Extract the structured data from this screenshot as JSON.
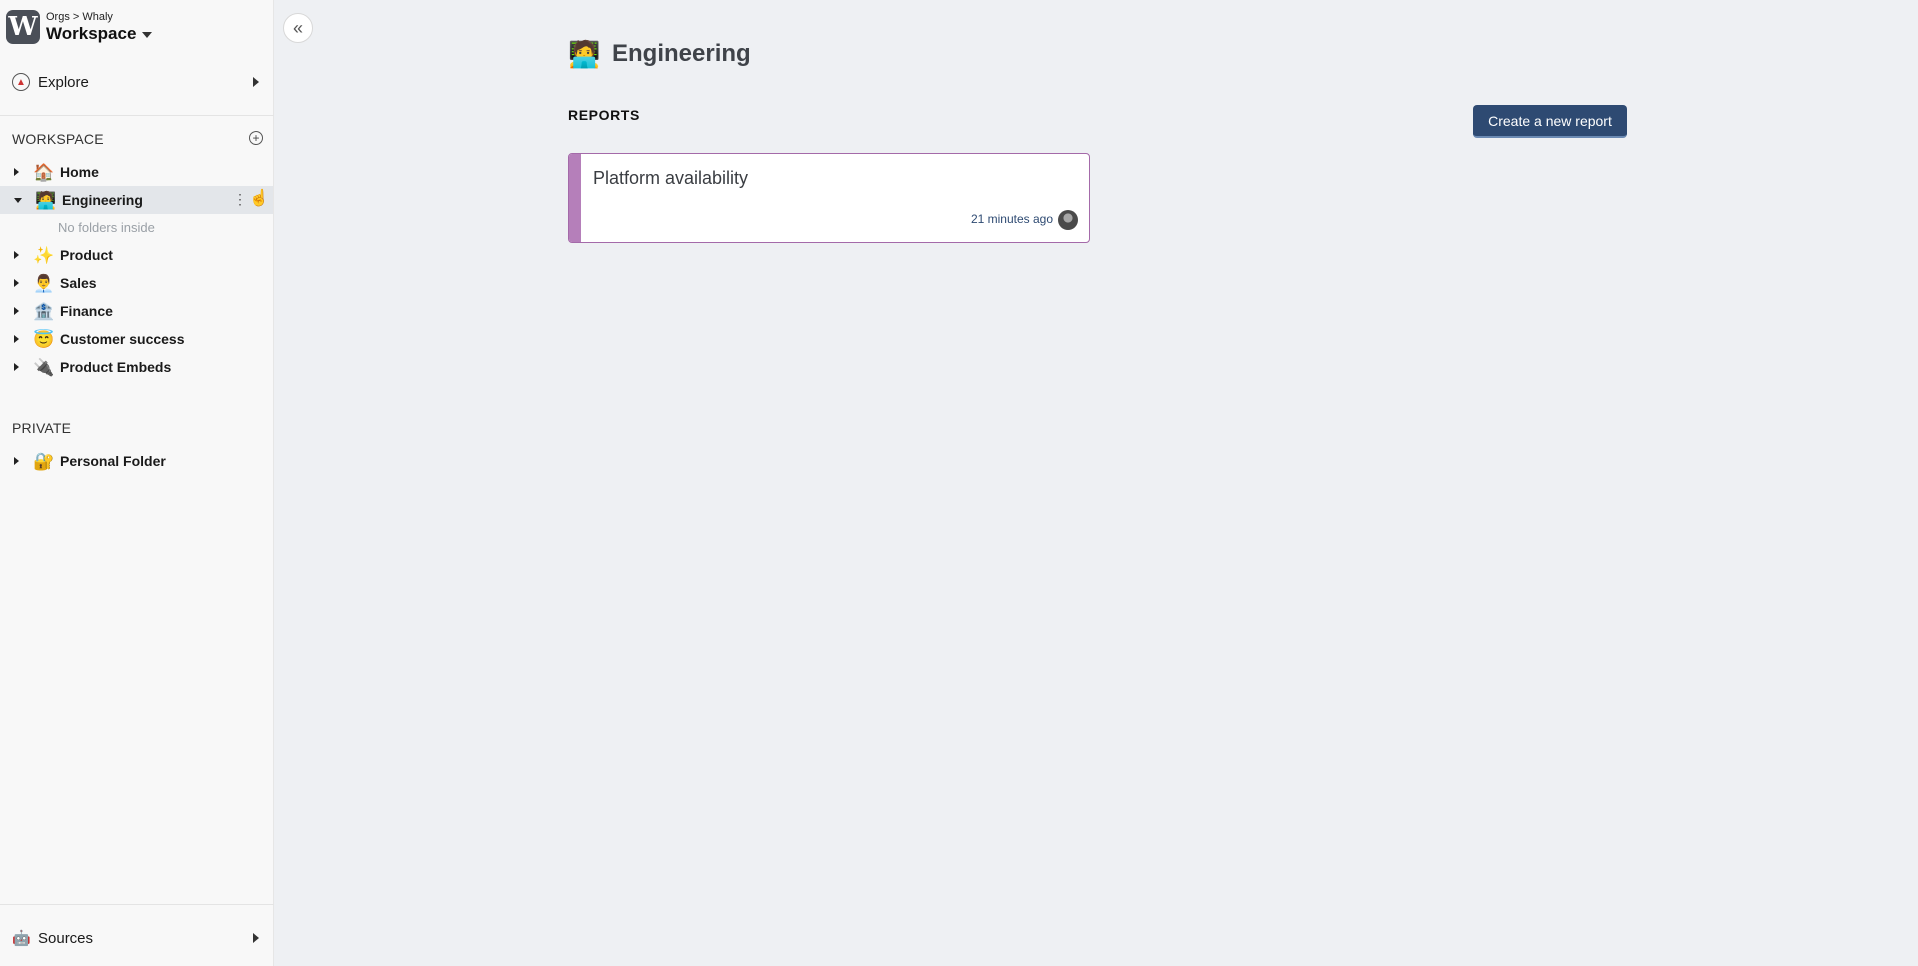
{
  "workspace": {
    "breadcrumb": "Orgs > Whaly",
    "name": "Workspace",
    "logo_letter": "W"
  },
  "sidebar": {
    "explore_label": "Explore",
    "workspace_section": "WORKSPACE",
    "items": [
      {
        "label": "Home",
        "icon": "🏠",
        "icon_name": "house-icon"
      },
      {
        "label": "Engineering",
        "icon": "🧑‍💻",
        "icon_name": "technologist-icon"
      },
      {
        "label": "Product",
        "icon": "✨",
        "icon_name": "sparkles-icon"
      },
      {
        "label": "Sales",
        "icon": "👨‍💼",
        "icon_name": "office-worker-icon"
      },
      {
        "label": "Finance",
        "icon": "🏦",
        "icon_name": "bank-icon"
      },
      {
        "label": "Customer success",
        "icon": "😇",
        "icon_name": "halo-face-icon"
      },
      {
        "label": "Product Embeds",
        "icon": "🔌",
        "icon_name": "plug-icon"
      }
    ],
    "empty_folder_note": "No folders inside",
    "private_section": "PRIVATE",
    "private_items": [
      {
        "label": "Personal Folder",
        "icon": "🔐",
        "icon_name": "lock-key-icon"
      }
    ],
    "sources_label": "Sources"
  },
  "main": {
    "title": "Engineering",
    "title_icon": "🧑‍💻",
    "reports_label": "REPORTS",
    "create_button": "Create a new report",
    "reports": [
      {
        "title": "Platform availability",
        "updated": "21 minutes ago"
      }
    ]
  },
  "colors": {
    "primary": "#2e4a72",
    "card_accent": "#b57fba",
    "background": "#eef0f3",
    "sidebar": "#f8f8f8"
  }
}
